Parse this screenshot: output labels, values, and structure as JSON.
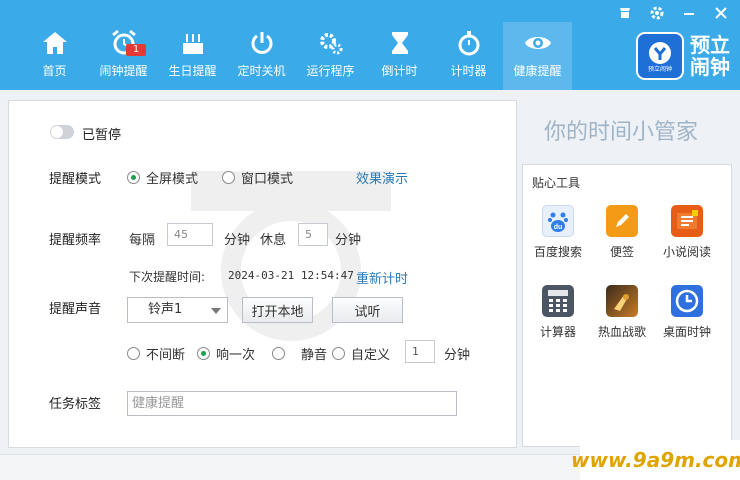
{
  "nav": [
    {
      "label": "首页",
      "icon": "home-icon"
    },
    {
      "label": "闹钟提醒",
      "icon": "alarm-clock-icon",
      "badge": "1"
    },
    {
      "label": "生日提醒",
      "icon": "birthday-cake-icon"
    },
    {
      "label": "定时关机",
      "icon": "power-icon"
    },
    {
      "label": "运行程序",
      "icon": "gears-icon"
    },
    {
      "label": "倒计时",
      "icon": "hourglass-icon"
    },
    {
      "label": "计时器",
      "icon": "stopwatch-icon"
    },
    {
      "label": "健康提醒",
      "icon": "eye-icon",
      "active": true
    }
  ],
  "logo": {
    "line1": "预立",
    "line2": "闹钟",
    "sub": "预立闹钟"
  },
  "toggle_label": "已暂停",
  "mode": {
    "label": "提醒模式",
    "options": [
      "全屏模式",
      "窗口模式"
    ],
    "selected": "全屏模式",
    "demo_link": "效果演示"
  },
  "freq": {
    "label": "提醒频率",
    "every": "每隔",
    "every_value": "45",
    "unit1": "分钟",
    "rest": "休息",
    "rest_value": "5",
    "unit2": "分钟"
  },
  "next": {
    "label": "下次提醒时间:",
    "time": "2024-03-21 12:54:47",
    "reset_link": "重新计时"
  },
  "sound": {
    "label": "提醒声音",
    "selected": "铃声1",
    "open_btn": "打开本地",
    "test_btn": "试听",
    "repeat_options": [
      "不间断",
      "响一次",
      "静音",
      "自定义"
    ],
    "repeat_selected": "响一次",
    "custom_value": "1",
    "custom_unit": "分钟"
  },
  "task": {
    "label": "任务标签",
    "value": "健康提醒"
  },
  "slogan": "你的时间小管家",
  "tools": {
    "title": "贴心工具",
    "items": [
      {
        "label": "百度搜索",
        "icon": "baidu-icon",
        "color": "#2f7fe6"
      },
      {
        "label": "便签",
        "icon": "note-pencil-icon",
        "color": "#f39a16"
      },
      {
        "label": "小说阅读",
        "icon": "novel-book-icon",
        "color": "#e85d16"
      },
      {
        "label": "计算器",
        "icon": "calculator-icon",
        "color": "#4b5563"
      },
      {
        "label": "热血战歌",
        "icon": "game-warrior-icon",
        "color": "#8a5a2b"
      },
      {
        "label": "桌面时钟",
        "icon": "desktop-clock-icon",
        "color": "#2f6fe0"
      }
    ]
  },
  "watermark": "www.9a9m.com"
}
